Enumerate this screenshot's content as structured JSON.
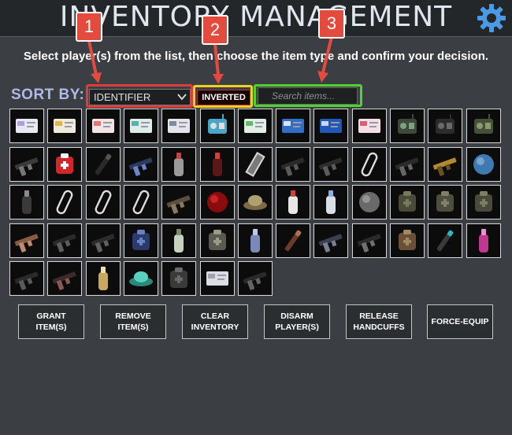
{
  "header": {
    "title": "INVENTORY MANAGEMENT",
    "settings_icon": "gear-icon"
  },
  "instructions": "Select player(s) from the list, then choose the item type and confirm your decision.",
  "sort": {
    "label": "SORT BY:",
    "selected": "IDENTIFIER",
    "inverted_label": "INVERTED",
    "search_placeholder": "Search items..."
  },
  "callouts": [
    "1",
    "2",
    "3"
  ],
  "items": [
    {
      "icon": "keycard-janitor-icon",
      "c1": "#e8e8f0",
      "c2": "#b39ddb"
    },
    {
      "icon": "keycard-scientist-icon",
      "c1": "#f0eadc",
      "c2": "#e0b64a"
    },
    {
      "icon": "keycard-research-icon",
      "c1": "#f0e4e4",
      "c2": "#e57373"
    },
    {
      "icon": "keycard-zone-manager-icon",
      "c1": "#e0ecea",
      "c2": "#4db6ac"
    },
    {
      "icon": "keycard-guard-icon",
      "c1": "#e4e4ea",
      "c2": "#7c8ca0"
    },
    {
      "icon": "radio-icon",
      "c1": "#4aa6c6",
      "c2": "#d8dfe4"
    },
    {
      "icon": "keycard-containment-icon",
      "c1": "#e2eee6",
      "c2": "#66bb6a"
    },
    {
      "icon": "keycard-operations-icon",
      "c1": "#2f6fc8",
      "c2": "#dbe4f4"
    },
    {
      "icon": "keycard-facility-icon",
      "c1": "#1e58b8",
      "c2": "#c8d6ee"
    },
    {
      "icon": "keycard-o5-icon",
      "c1": "#f4dfe6",
      "c2": "#e05a7a"
    },
    {
      "icon": "walkie-talkie-icon",
      "c1": "#3c4a3c",
      "c2": "#7da07d"
    },
    {
      "icon": "tablet-icon",
      "c1": "#2c2c2c",
      "c2": "#6a6a6a"
    },
    {
      "icon": "radio-handset-icon",
      "c1": "#45503a",
      "c2": "#8a9a6a"
    },
    {
      "icon": "pistol-icon",
      "c1": "#3a3a3a",
      "c2": "#777777"
    },
    {
      "icon": "medkit-icon",
      "c1": "#d02828",
      "c2": "#ffffff"
    },
    {
      "icon": "flashlight-icon",
      "c1": "#2a2a2a",
      "c2": "#555555"
    },
    {
      "icon": "micro-hid-icon",
      "c1": "#2c3a5c",
      "c2": "#6a86c8"
    },
    {
      "icon": "canister-icon",
      "c1": "#9a9a9a",
      "c2": "#c84040"
    },
    {
      "icon": "cola-bottle-icon",
      "c1": "#5a1818",
      "c2": "#d84040"
    },
    {
      "icon": "coin-strip-icon",
      "c1": "#d8d8d8",
      "c2": "#7a7a7a"
    },
    {
      "icon": "rifle-icon",
      "c1": "#2a2a2a",
      "c2": "#5a5a5a"
    },
    {
      "icon": "revolver-icon",
      "c1": "#2c2c2c",
      "c2": "#5c5c5c"
    },
    {
      "icon": "ammo-outline-icon",
      "c1": "#dddddd",
      "c2": "#0c0c0c"
    },
    {
      "icon": "smg-icon",
      "c1": "#2a2a2a",
      "c2": "#666666"
    },
    {
      "icon": "golden-gun-icon",
      "c1": "#b08a30",
      "c2": "#6a5020"
    },
    {
      "icon": "grenade-icon",
      "c1": "#3e7ab0",
      "c2": "#8fb8dd"
    },
    {
      "icon": "flashbang-icon",
      "c1": "#3a3a3a",
      "c2": "#8a8a8a"
    },
    {
      "icon": "ammo-outline-icon",
      "c1": "#dddddd",
      "c2": "#0c0c0c"
    },
    {
      "icon": "ammo-outline-icon",
      "c1": "#dddddd",
      "c2": "#0c0c0c"
    },
    {
      "icon": "ammo-outline-icon",
      "c1": "#dddddd",
      "c2": "#0c0c0c"
    },
    {
      "icon": "handgun-icon",
      "c1": "#5a5040",
      "c2": "#8a7a60"
    },
    {
      "icon": "red-orb-icon",
      "c1": "#8a0c0c",
      "c2": "#e03030"
    },
    {
      "icon": "hat-icon",
      "c1": "#7a6a48",
      "c2": "#b0a070"
    },
    {
      "icon": "adrenaline-icon",
      "c1": "#e6e6e6",
      "c2": "#d04040"
    },
    {
      "icon": "painkillers-icon",
      "c1": "#d8dde6",
      "c2": "#8ab0e0"
    },
    {
      "icon": "coin-icon",
      "c1": "#6a6a6a",
      "c2": "#a8a8a8"
    },
    {
      "icon": "light-armor-icon",
      "c1": "#4a4a3a",
      "c2": "#7a7a5a"
    },
    {
      "icon": "combat-armor-icon",
      "c1": "#4e4e3e",
      "c2": "#80806a"
    },
    {
      "icon": "heavy-armor-icon",
      "c1": "#4a4a3c",
      "c2": "#7e7e66"
    },
    {
      "icon": "shotgun-icon",
      "c1": "#8a5a44",
      "c2": "#c08a70"
    },
    {
      "icon": "assault-rifle-icon",
      "c1": "#2a2a2a",
      "c2": "#5e5e5e"
    },
    {
      "icon": "carbine-icon",
      "c1": "#2c2c2c",
      "c2": "#606060"
    },
    {
      "icon": "bag-icon",
      "c1": "#2a3a6a",
      "c2": "#6a80c0"
    },
    {
      "icon": "light-bulb-icon",
      "c1": "#c8d0c0",
      "c2": "#7a8a6a"
    },
    {
      "icon": "sack-icon",
      "c1": "#5a5a50",
      "c2": "#9a9a88"
    },
    {
      "icon": "flask-icon",
      "c1": "#7a8ab8",
      "c2": "#c0c8e8"
    },
    {
      "icon": "cigar-icon",
      "c1": "#6a3a2a",
      "c2": "#b07050"
    },
    {
      "icon": "machine-gun-icon",
      "c1": "#3a4050",
      "c2": "#7a8090"
    },
    {
      "icon": "combat-pistol-icon",
      "c1": "#2a2a2a",
      "c2": "#707070"
    },
    {
      "icon": "backpack-icon",
      "c1": "#6a5038",
      "c2": "#a08860"
    },
    {
      "icon": "wand-icon",
      "c1": "#3a3a3a",
      "c2": "#2ab8c0"
    },
    {
      "icon": "pink-bottle-icon",
      "c1": "#c03890",
      "c2": "#f090d0"
    },
    {
      "icon": "sniper-rifle-icon",
      "c1": "#2a2a2a",
      "c2": "#5a5a5a"
    },
    {
      "icon": "ak-rifle-icon",
      "c1": "#3a2a2a",
      "c2": "#8a5a50"
    },
    {
      "icon": "lantern-icon",
      "c1": "#c8a860",
      "c2": "#f0e0b0"
    },
    {
      "icon": "goggles-icon",
      "c1": "#2a8a7a",
      "c2": "#5ad0c0"
    },
    {
      "icon": "pouch-icon",
      "c1": "#3a3a3a",
      "c2": "#6a6a6a"
    },
    {
      "icon": "paper-card-icon",
      "c1": "#dcdce4",
      "c2": "#a0a0b0"
    },
    {
      "icon": "gatling-icon",
      "c1": "#2a2a2a",
      "c2": "#646464"
    }
  ],
  "actions": [
    {
      "label": "GRANT\nITEM(S)"
    },
    {
      "label": "REMOVE\nITEM(S)"
    },
    {
      "label": "CLEAR\nINVENTORY"
    },
    {
      "label": "DISARM\nPLAYER(S)"
    },
    {
      "label": "RELEASE\nHANDCUFFS"
    },
    {
      "label": "FORCE-EQUIP"
    }
  ]
}
